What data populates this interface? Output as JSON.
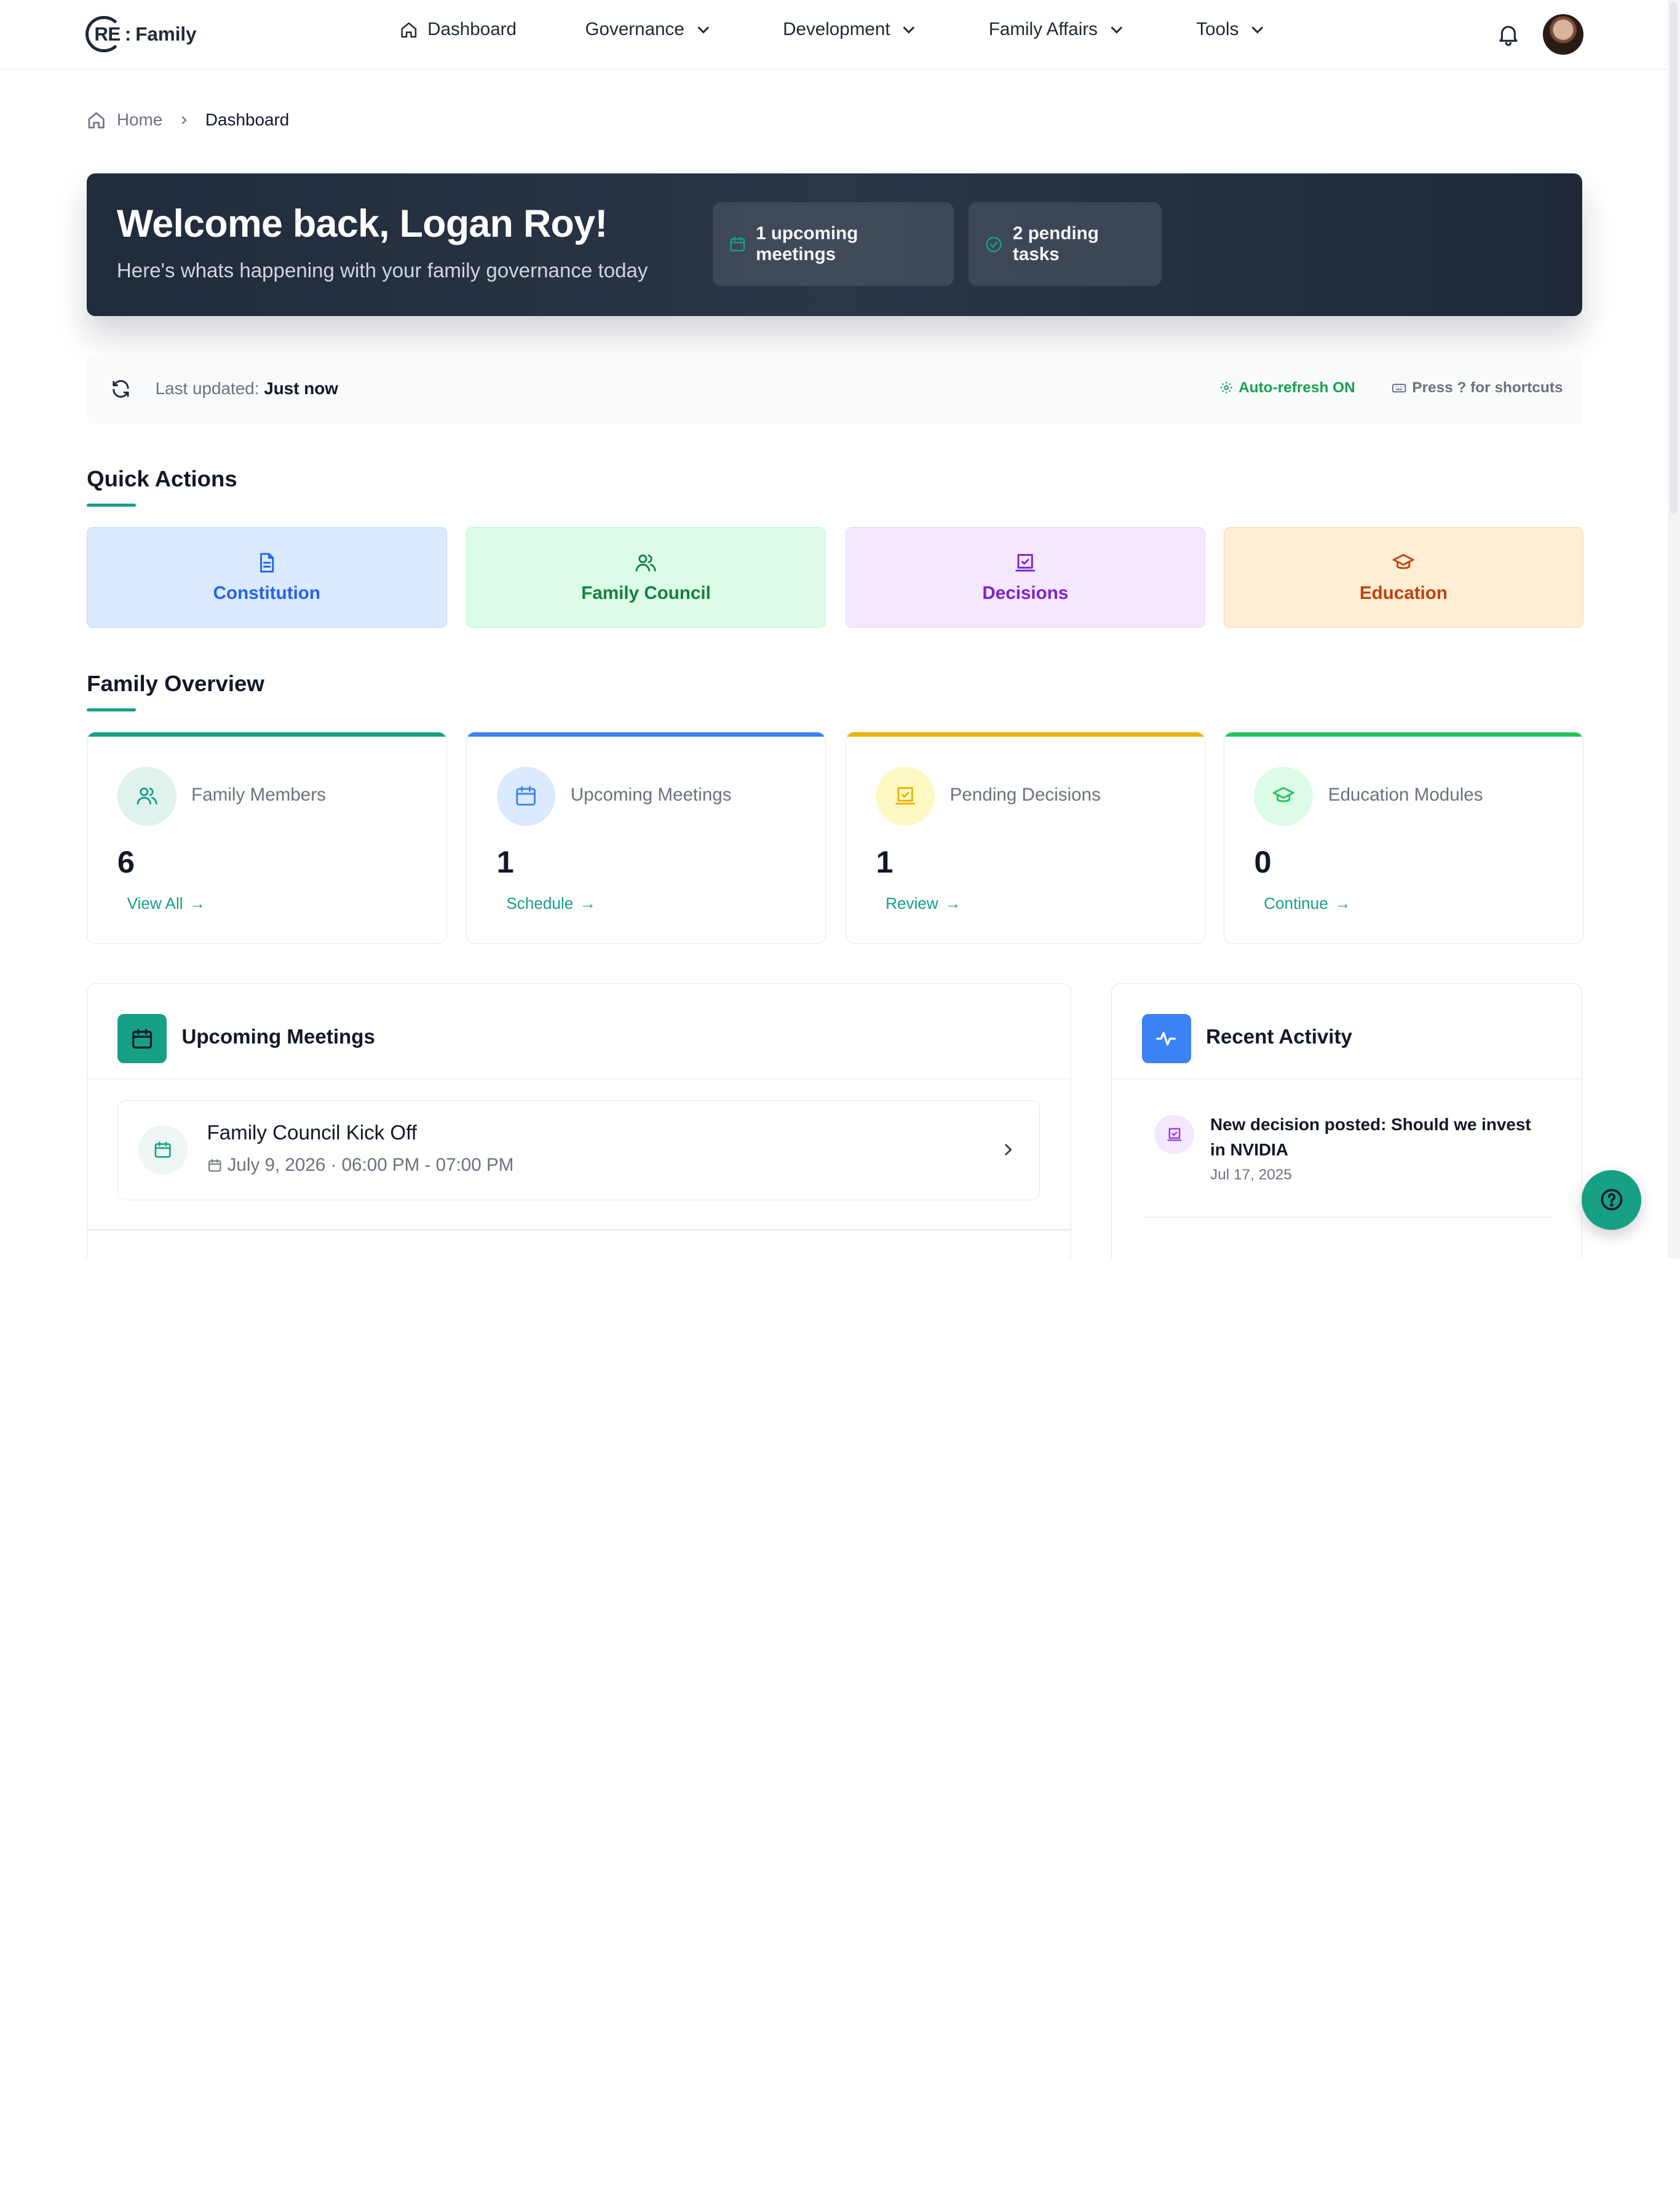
{
  "brand": {
    "re": "RE",
    "colon": ":",
    "family": "Family"
  },
  "nav": {
    "dashboard": "Dashboard",
    "governance": "Governance",
    "development": "Development",
    "family_affairs": "Family Affairs",
    "tools": "Tools"
  },
  "breadcrumb": {
    "home": "Home",
    "current": "Dashboard"
  },
  "hero": {
    "title": "Welcome back, Logan Roy!",
    "subtitle": "Here's whats happening with your family governance today",
    "meetings_pill": "1 upcoming meetings",
    "tasks_pill": "2 pending tasks"
  },
  "status": {
    "last_updated_label": "Last updated:",
    "last_updated_value": "Just now",
    "auto_refresh": "Auto-refresh ON",
    "shortcuts": "Press ? for shortcuts"
  },
  "quick_actions": {
    "title": "Quick Actions",
    "items": [
      {
        "label": "Constitution",
        "color": "#2563eb",
        "bg": "#dbeafe",
        "border": "#bfdbfe",
        "icon": "document-icon"
      },
      {
        "label": "Family Council",
        "color": "#15803d",
        "bg": "#dcfce7",
        "border": "#bbf7d0",
        "icon": "users-icon"
      },
      {
        "label": "Decisions",
        "color": "#7e22ce",
        "bg": "#f3e8ff",
        "border": "#e9d5ff",
        "icon": "vote-icon"
      },
      {
        "label": "Education",
        "color": "#c2410c",
        "bg": "#ffedd5",
        "border": "#fed7aa",
        "icon": "graduation-cap-icon"
      }
    ]
  },
  "overview": {
    "title": "Family Overview",
    "cards": [
      {
        "label": "Family Members",
        "value": "6",
        "link": "View All",
        "accent": "#16a085",
        "circle_bg": "#e0f2ee",
        "icon": "users-icon"
      },
      {
        "label": "Upcoming Meetings",
        "value": "1",
        "link": "Schedule",
        "accent": "#3b82f6",
        "circle_bg": "#dbeafe",
        "icon": "calendar-icon"
      },
      {
        "label": "Pending Decisions",
        "value": "1",
        "link": "Review",
        "accent": "#eab308",
        "circle_bg": "#fef9c3",
        "icon": "vote-icon"
      },
      {
        "label": "Education Modules",
        "value": "0",
        "link": "Continue",
        "accent": "#22c55e",
        "circle_bg": "#dcfce7",
        "icon": "graduation-cap-icon"
      }
    ]
  },
  "meetings_panel": {
    "title": "Upcoming Meetings",
    "items": [
      {
        "title": "Family Council Kick Off",
        "time": "July 9, 2026 · 06:00 PM - 07:00 PM"
      }
    ]
  },
  "activity_panel": {
    "title": "Recent Activity",
    "items": [
      {
        "text": "New decision posted: Should we invest in NVIDIA",
        "date": "Jul 17, 2025"
      }
    ]
  }
}
